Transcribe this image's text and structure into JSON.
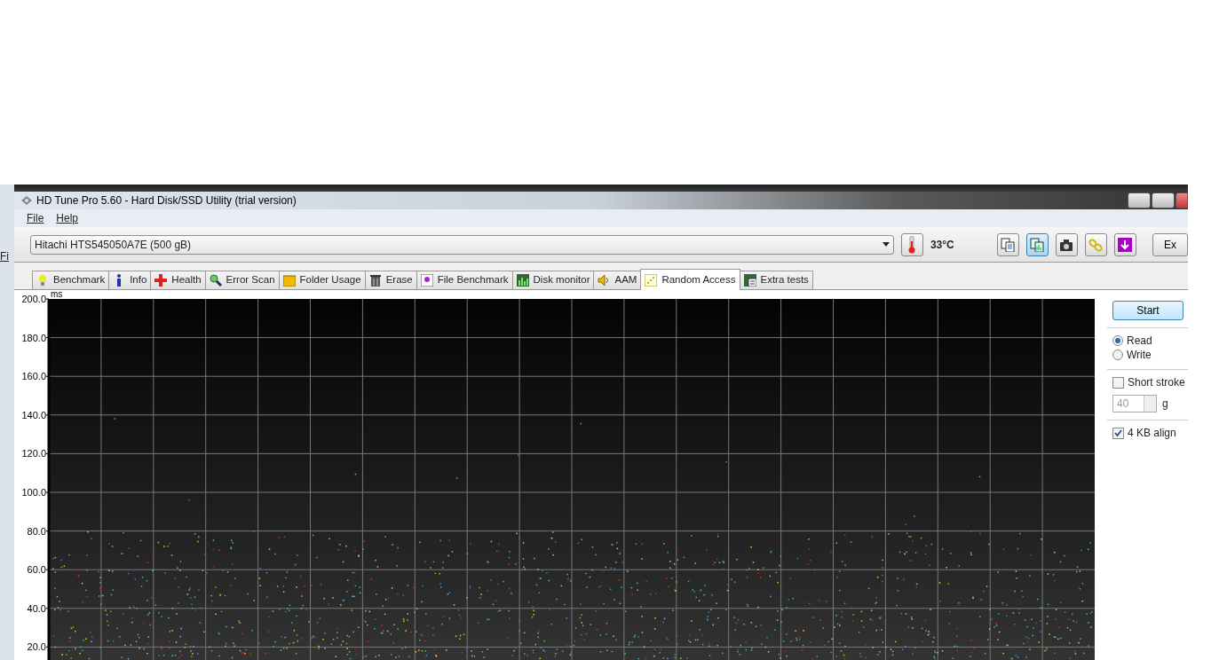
{
  "background_window": {
    "menu_text": "Fi"
  },
  "window": {
    "title": "HD Tune Pro 5.60 - Hard Disk/SSD Utility (trial version)"
  },
  "menu": [
    "File",
    "Help"
  ],
  "drive_select": {
    "value": "Hitachi HTS545050A7E (500 gB)"
  },
  "temperature": "33°C",
  "toolbar_buttons": [
    {
      "selected": false
    },
    {
      "selected": true
    },
    {
      "selected": false
    },
    {
      "selected": false
    },
    {
      "selected": false
    }
  ],
  "exit_button": "Ex",
  "tabs": [
    {
      "label": "Benchmark",
      "selected": false
    },
    {
      "label": "Info",
      "selected": false
    },
    {
      "label": "Health",
      "selected": false
    },
    {
      "label": "Error Scan",
      "selected": false
    },
    {
      "label": "Folder Usage",
      "selected": false
    },
    {
      "label": "Erase",
      "selected": false
    },
    {
      "label": "File Benchmark",
      "selected": false
    },
    {
      "label": "Disk monitor",
      "selected": false
    },
    {
      "label": "AAM",
      "selected": false
    },
    {
      "label": "Random Access",
      "selected": true
    },
    {
      "label": "Extra tests",
      "selected": false
    }
  ],
  "chart": {
    "unit": "ms",
    "y_labels": [
      "200.0",
      "180.0",
      "160.0",
      "140.0",
      "120.0",
      "100.0",
      "80.0",
      "60.0",
      "40.0",
      "20.0"
    ]
  },
  "side_panel": {
    "start_button": "Start",
    "modes": [
      {
        "label": "Read",
        "selected": true
      },
      {
        "label": "Write",
        "selected": false
      }
    ],
    "short_stroke": {
      "label": "Short stroke",
      "checked": false
    },
    "stroke_size": {
      "value": "40",
      "disabled": true,
      "unit": "g"
    },
    "align": {
      "label": "4 KB align",
      "checked": true
    }
  }
}
